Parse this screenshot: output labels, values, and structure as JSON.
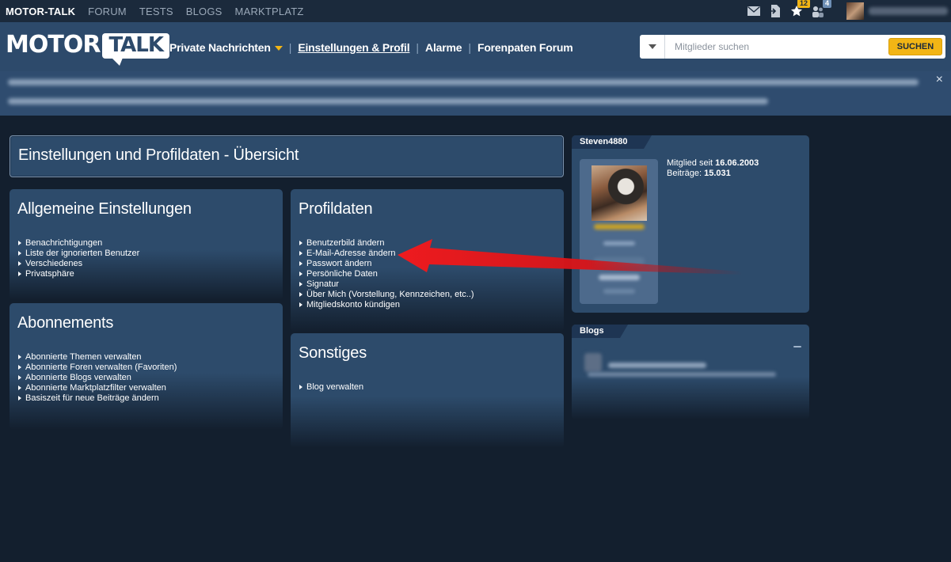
{
  "topbar": {
    "nav": [
      "MOTOR-TALK",
      "FORUM",
      "TESTS",
      "BLOGS",
      "MARKTPLATZ"
    ],
    "icons": [
      "mail-icon",
      "document-arrow-icon",
      "star-icon",
      "users-icon"
    ],
    "star_badge": "12",
    "users_badge": "4"
  },
  "header": {
    "logo_left": "MOTOR",
    "logo_right": "TALK",
    "nav": [
      {
        "label": "Private Nachrichten"
      },
      {
        "label": "Einstellungen & Profil"
      },
      {
        "label": "Alarme"
      },
      {
        "label": "Forenpaten Forum"
      }
    ],
    "search_placeholder": "Mitglieder suchen",
    "search_button": "SUCHEN"
  },
  "banner": {
    "close": "×"
  },
  "page_title": "Einstellungen und Profildaten - Übersicht",
  "general": {
    "title": "Allgemeine Einstellungen",
    "items": [
      "Benachrichtigungen",
      "Liste der ignorierten Benutzer",
      "Verschiedenes",
      "Privatsphäre"
    ]
  },
  "subscriptions": {
    "title": "Abonnements",
    "items": [
      "Abonnierte Themen verwalten",
      "Abonnierte Foren verwalten (Favoriten)",
      "Abonnierte Blogs verwalten",
      "Abonnierte Marktplatzfilter verwalten",
      "Basiszeit für neue Beiträge ändern"
    ]
  },
  "profile": {
    "title": "Profildaten",
    "items": [
      "Benutzerbild ändern",
      "E-Mail-Adresse ändern",
      "Passwort ändern",
      "Persönliche Daten",
      "Signatur",
      "Über Mich (Vorstellung, Kennzeichen, etc..)",
      "Mitgliedskonto kündigen"
    ]
  },
  "misc": {
    "title": "Sonstiges",
    "items": [
      "Blog verwalten"
    ]
  },
  "user": {
    "name": "Steven4880",
    "member_since_label": "Mitglied seit",
    "member_since": "16.06.2003",
    "posts_label": "Beiträge:",
    "posts": "15.031"
  },
  "blogs": {
    "title": "Blogs"
  },
  "colors": {
    "background": "#131f2e",
    "panel": "#2d4b6b",
    "accent": "#f2b515",
    "arrow": "#e0151b"
  }
}
